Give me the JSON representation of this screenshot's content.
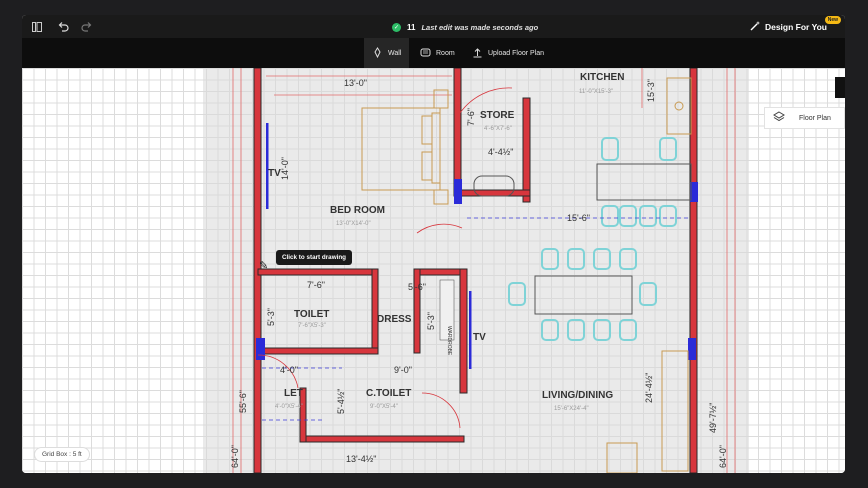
{
  "topbar": {
    "sidebar_icon": "panel-icon",
    "undo_icon": "undo-icon",
    "redo_icon": "redo-icon",
    "edit_count": "11",
    "status_message": "Last edit was made seconds ago",
    "design_for_you": "Design For You",
    "new_badge": "New"
  },
  "toolbar": {
    "tools": [
      {
        "label": "Wall",
        "icon": "wall-icon",
        "active": true
      },
      {
        "label": "Room",
        "icon": "room-icon",
        "active": false
      },
      {
        "label": "Upload Floor Plan",
        "icon": "upload-icon",
        "active": false
      }
    ]
  },
  "side_panel": {
    "label": "Floor Plan",
    "icon": "layers-icon"
  },
  "tooltip": "Click to start drawing",
  "grid_box": "Grid Box : 5 ft",
  "plan": {
    "rooms": {
      "kitchen": "KITCHEN",
      "kitchen_dim": "11'-0\"X15'-3\"",
      "store": "STORE",
      "store_dim": "4'-6\"X7'-6\"",
      "bedroom": "BED ROOM",
      "bedroom_dim": "13'-0\"X14'-0\"",
      "toilet": "TOILET",
      "toilet_dim": "7'-6\"X5'-3\"",
      "dress": "DRESS",
      "ctoilet": "C.TOILET",
      "ctoilet_dim": "9'-0\"X5'-4\"",
      "let": "LET",
      "let_dim": "4'-0\"X5'-4\"",
      "living": "LIVING/DINING",
      "living_dim": "15'-6\"X24'-4\"",
      "wardrobe": "WARDROBE",
      "tv1": "TV",
      "tv2": "TV"
    },
    "dims": {
      "top_13": "13'-0\"",
      "v_14": "14'-0\"",
      "store_76": "7'-6\"",
      "store_45": "4'-4½\"",
      "k_153": "15'-3\"",
      "mid_156": "15'-6\"",
      "t_76": "7'-6\"",
      "d_56": "5'-6\"",
      "t_53": "5'-3\"",
      "d_53": "5'-3\"",
      "l_40": "4'-0\"",
      "c_90": "9'-0\"",
      "c_54": "5'-4½\"",
      "left_556": "55'-6\"",
      "left_640": "64'-0\"",
      "right_244": "24'-4½\"",
      "right_4972": "49'-7½\"",
      "right_640": "64'-0\"",
      "bot_13": "13'-4½\"",
      "left_l4": "5'-4½\""
    }
  },
  "colors": {
    "wall": "#d7363d",
    "wall_dark": "#3a3a3a",
    "window": "#2b2bd8",
    "furniture_brown": "#c89a52",
    "furniture_cyan": "#7fd3d7",
    "topbar": "#1a1a1a"
  }
}
